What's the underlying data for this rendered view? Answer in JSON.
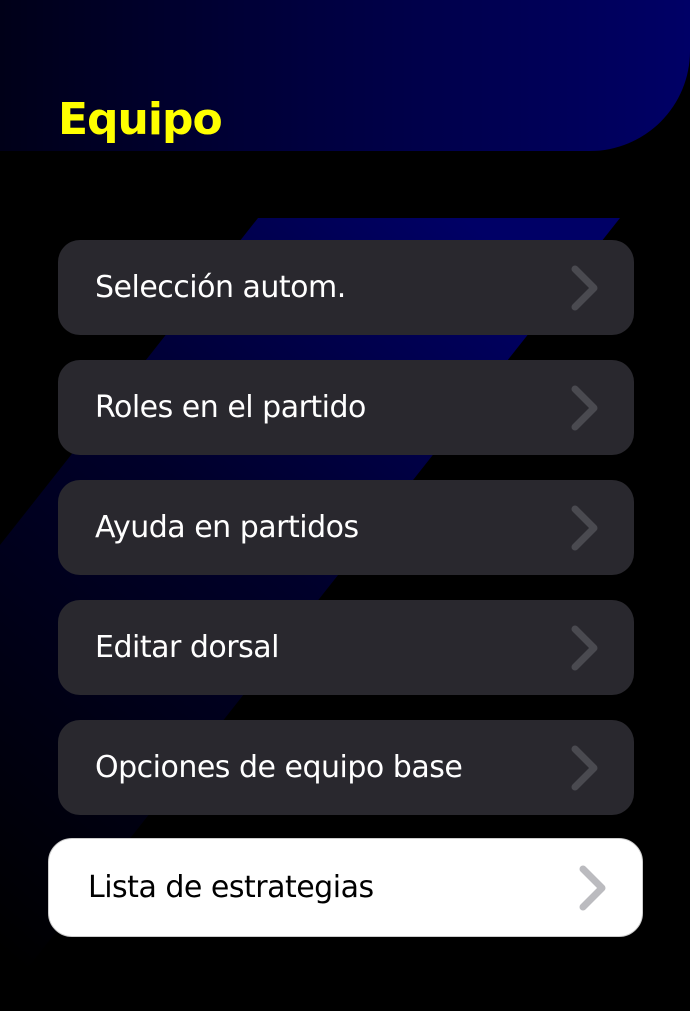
{
  "header": {
    "title": "Equipo"
  },
  "menu": {
    "items": [
      {
        "label": "Selección autom.",
        "icon": "chevron-right-icon"
      },
      {
        "label": "Roles en el partido",
        "icon": "chevron-right-icon"
      },
      {
        "label": "Ayuda en partidos",
        "icon": "chevron-right-icon"
      },
      {
        "label": "Editar dorsal",
        "icon": "chevron-right-icon"
      },
      {
        "label": "Opciones de equipo base",
        "icon": "chevron-right-icon"
      },
      {
        "label": "Lista de estrategias",
        "icon": "chevron-right-icon",
        "selected": true
      }
    ]
  },
  "colors": {
    "accent": "#ffff00",
    "navy": "#000066",
    "item_bg": "#29282e",
    "selected_bg": "#ffffff"
  }
}
